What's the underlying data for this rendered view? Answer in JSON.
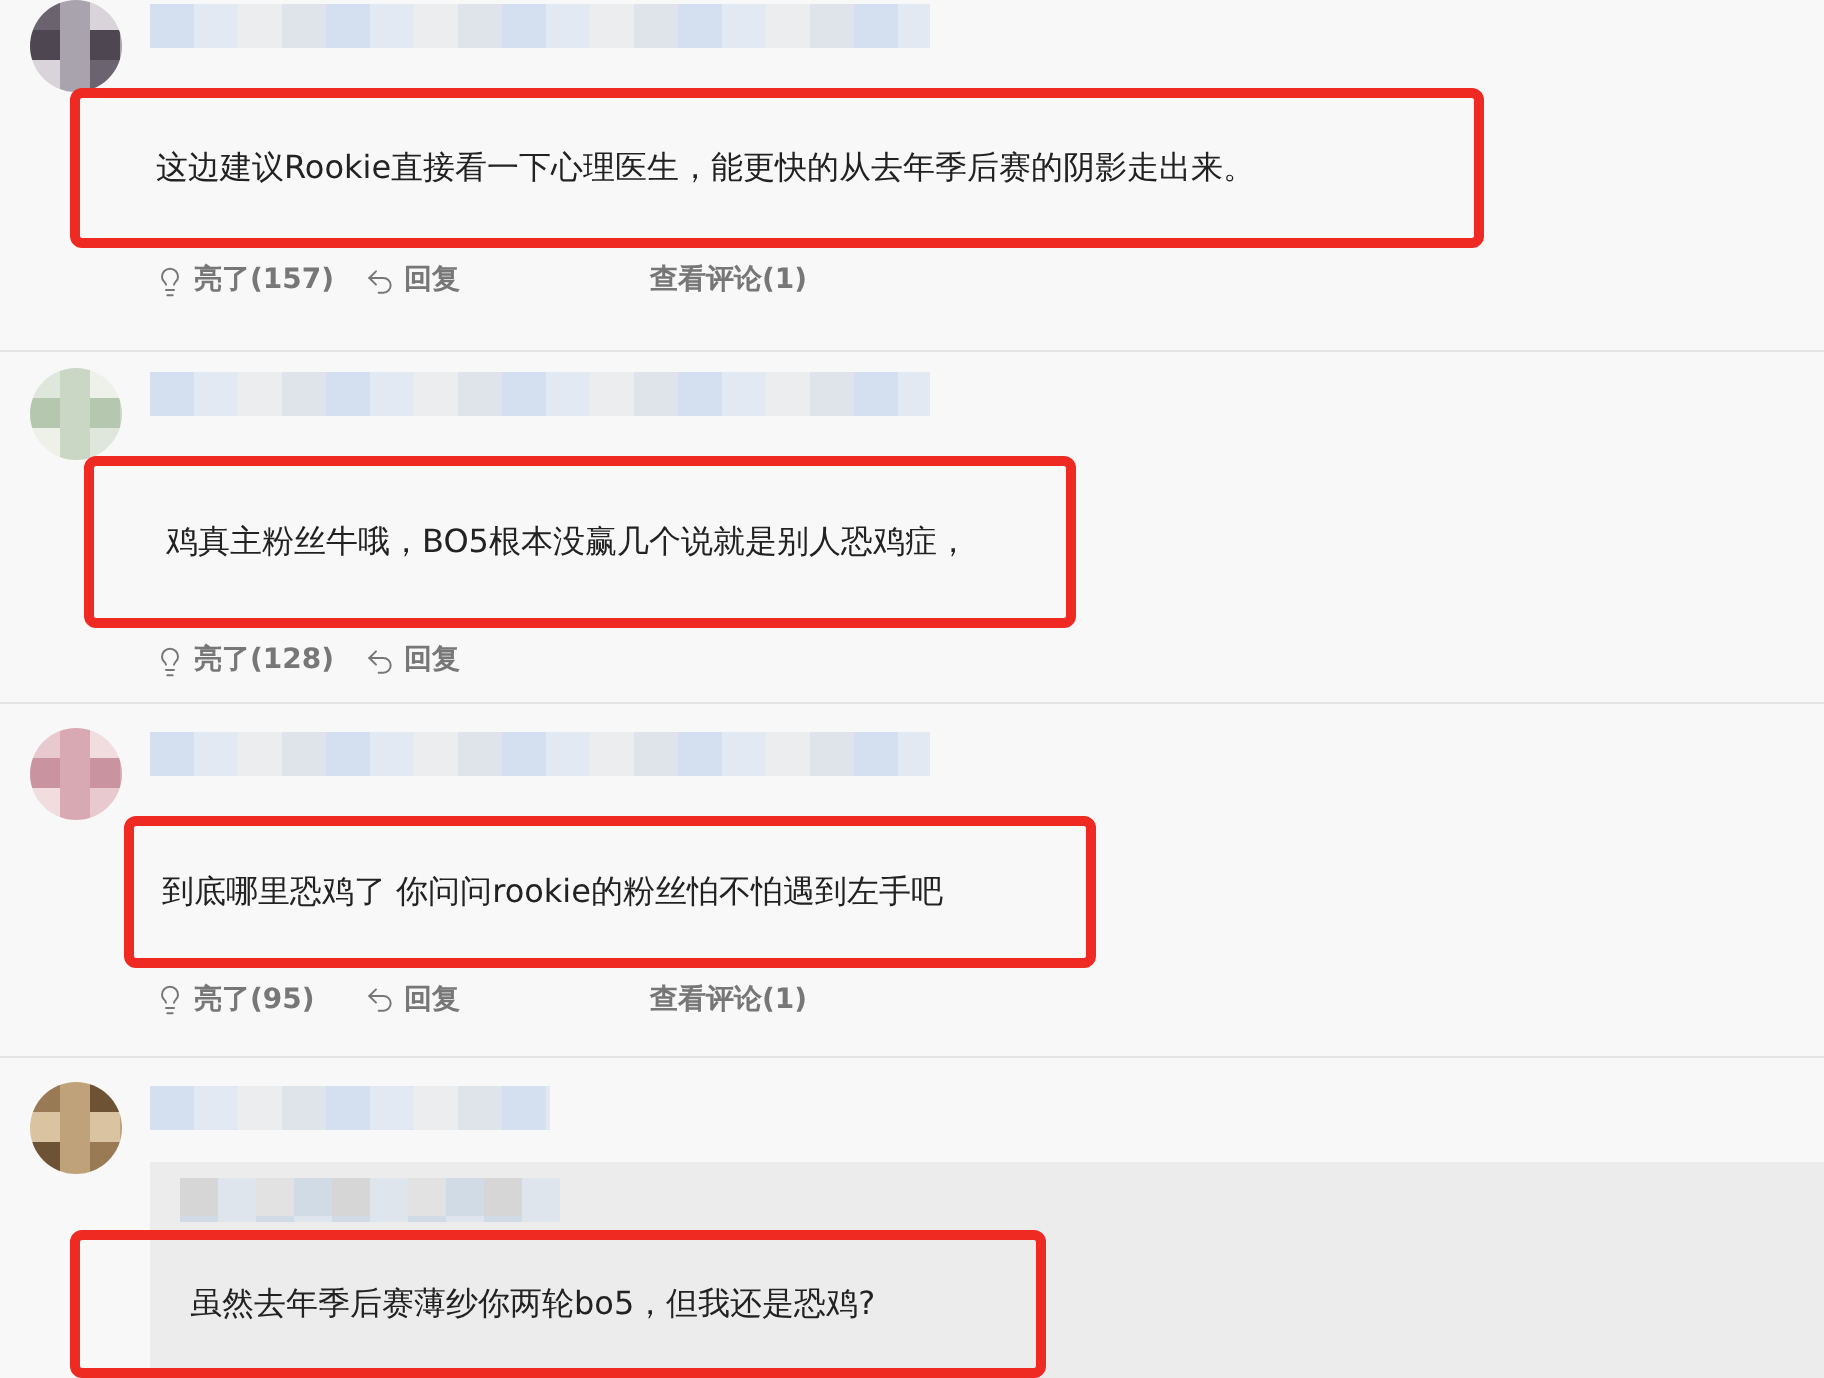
{
  "comments": [
    {
      "kind": "comment",
      "highlighted": true,
      "text": "这边建议Rookie直接看一下心理医生，能更快的从去年季后赛的阴影走出来。",
      "actions": [
        {
          "kind": "like",
          "label": "亮了(157)"
        },
        {
          "kind": "reply",
          "label": "回复"
        },
        {
          "kind": "view",
          "label": "查看评论(1)"
        }
      ]
    },
    {
      "kind": "comment",
      "highlighted": true,
      "text": "鸡真主粉丝牛哦，BO5根本没赢几个说就是别人恐鸡症，",
      "actions": [
        {
          "kind": "like",
          "label": "亮了(128)"
        },
        {
          "kind": "reply",
          "label": "回复"
        }
      ]
    },
    {
      "kind": "comment",
      "highlighted": true,
      "text": "到底哪里恐鸡了 你问问rookie的粉丝怕不怕遇到左手吧",
      "actions": [
        {
          "kind": "like",
          "label": "亮了(95)"
        },
        {
          "kind": "reply",
          "label": "回复"
        },
        {
          "kind": "view",
          "label": "查看评论(1)"
        }
      ]
    },
    {
      "kind": "quoted_reply",
      "highlighted": true,
      "text": "虽然去年季后赛薄纱你两轮bo5，但我还是恐鸡?"
    }
  ]
}
